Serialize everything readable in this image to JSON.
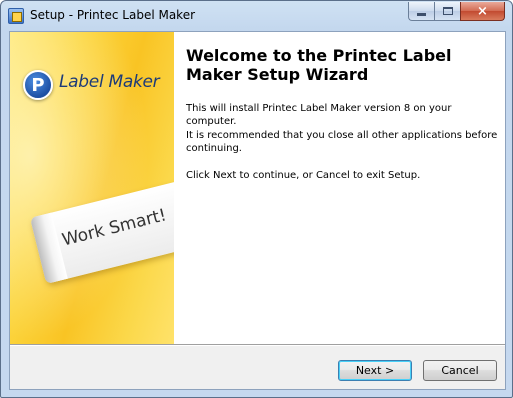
{
  "window": {
    "title": "Setup - Printec Label Maker",
    "icon": "setup-installer-icon",
    "controls": {
      "minimize": "minimize-icon",
      "maximize": "maximize-icon",
      "close": "×"
    }
  },
  "side_panel": {
    "logo_letter": "P",
    "logo_text": "Label Maker",
    "label_card_text": "Work Smart!",
    "colors": {
      "background": "#f9c424",
      "logo": "#1d4fa3"
    }
  },
  "content": {
    "heading": "Welcome to the Printec Label Maker Setup Wizard",
    "paragraphs": [
      "This will install Printec Label Maker version 8 on your computer.",
      "It is recommended that you close all other applications before continuing.",
      "Click Next to continue, or Cancel to exit Setup."
    ]
  },
  "buttons": {
    "next": "Next >",
    "cancel": "Cancel"
  }
}
